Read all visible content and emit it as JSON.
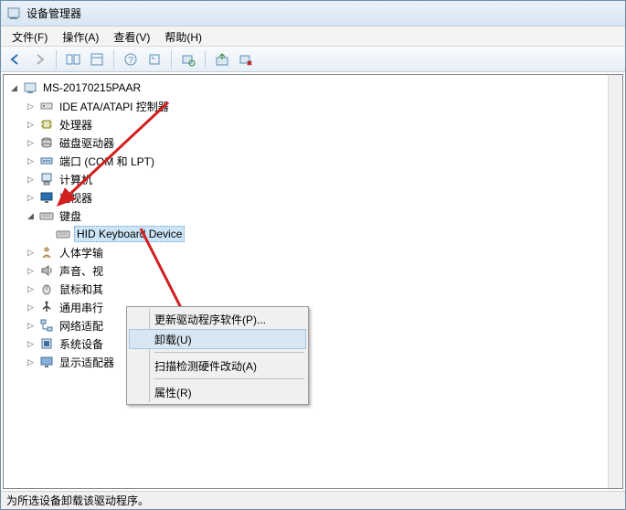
{
  "window": {
    "title": "设备管理器"
  },
  "menu": {
    "file": "文件(F)",
    "action": "操作(A)",
    "view": "查看(V)",
    "help": "帮助(H)"
  },
  "tree": {
    "root": "MS-20170215PAAR",
    "items": [
      {
        "label": "IDE ATA/ATAPI 控制器",
        "icon": "ide"
      },
      {
        "label": "处理器",
        "icon": "cpu"
      },
      {
        "label": "磁盘驱动器",
        "icon": "disk"
      },
      {
        "label": "端口 (COM 和 LPT)",
        "icon": "port"
      },
      {
        "label": "计算机",
        "icon": "computer"
      },
      {
        "label": "监视器",
        "icon": "monitor"
      },
      {
        "label": "键盘",
        "icon": "keyboard",
        "expanded": true,
        "children": [
          {
            "label": "HID Keyboard Device",
            "icon": "keyboard"
          }
        ]
      },
      {
        "label": "人体学输",
        "icon": "hid"
      },
      {
        "label": "声音、视",
        "icon": "sound"
      },
      {
        "label": "鼠标和其",
        "icon": "mouse"
      },
      {
        "label": "通用串行",
        "icon": "usb"
      },
      {
        "label": "网络适配",
        "icon": "network"
      },
      {
        "label": "系统设备",
        "icon": "system"
      },
      {
        "label": "显示适配器",
        "icon": "display"
      }
    ]
  },
  "context_menu": {
    "update_driver": "更新驱动程序软件(P)...",
    "uninstall": "卸载(U)",
    "scan_changes": "扫描检测硬件改动(A)",
    "properties": "属性(R)"
  },
  "status": "为所选设备卸载该驱动程序。"
}
